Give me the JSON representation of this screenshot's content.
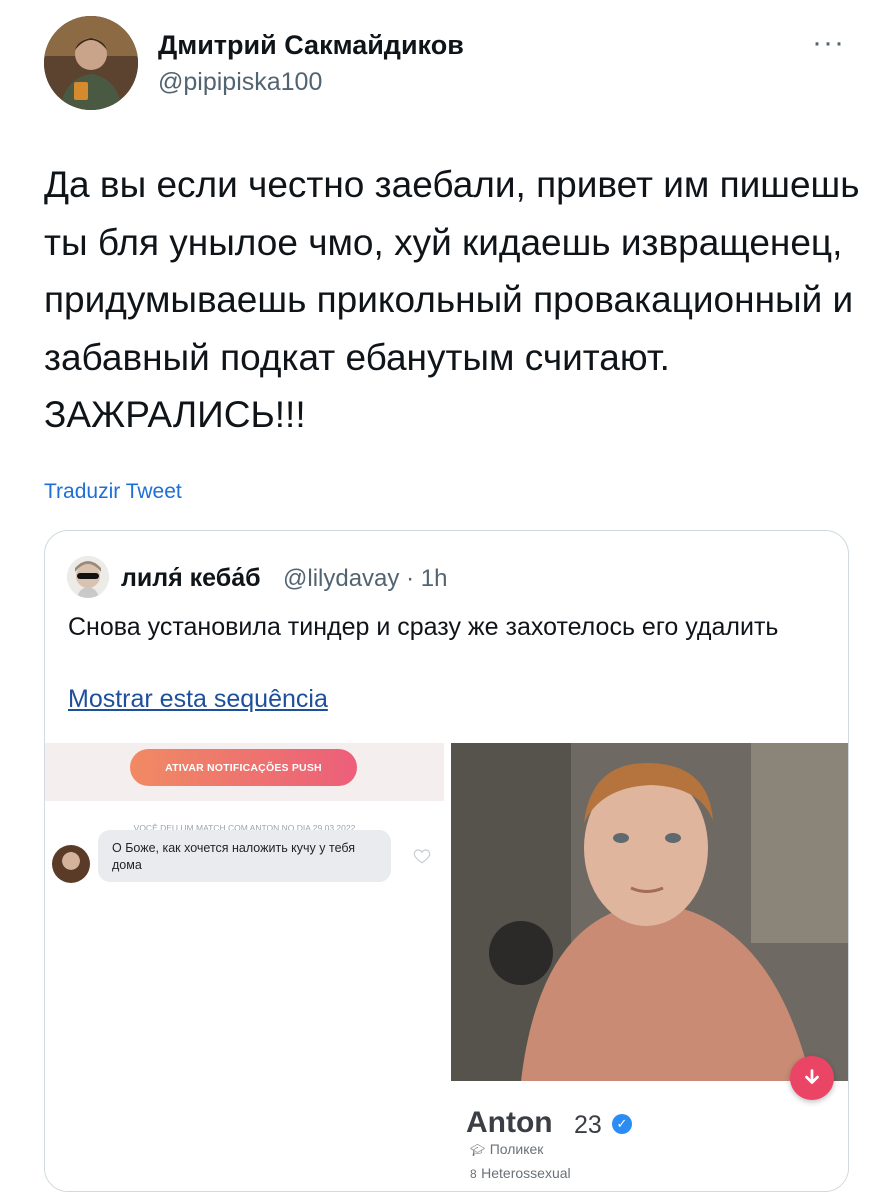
{
  "tweet": {
    "author_name": "Дмитрий Сакмайдиков",
    "author_handle": "@pipipiska100",
    "more_label": "···",
    "text": "Да вы если честно заебали, привет им пишешь ты бля унылое чмо, хуй кидаешь извращенец, придумываешь прикольный провакационный и забавный подкат ебанутым считают. ЗАЖРАЛИСЬ!!!",
    "translate_label": "Traduzir Tweet"
  },
  "quote": {
    "author_name": "лиля́ кеба́б",
    "author_handle": "@lilydavay · 1h",
    "text": "Снова установила тиндер и сразу же захотелось его удалить",
    "show_thread_label": "Mostrar esta sequência"
  },
  "chat_screenshot": {
    "push_button_label": "ATIVAR NOTIFICAÇÕES PUSH",
    "match_notice": "VOCÊ DEU UM MATCH COM ANTON NO DIA 29.03.2022",
    "message_text": "О Боже, как хочется наложить кучу у тебя дома"
  },
  "profile_screenshot": {
    "name": "Anton",
    "age": "23",
    "line1": "Поликек",
    "line2": "Heterossexual"
  },
  "icons": [
    "more-icon",
    "verified-icon",
    "download-icon",
    "heart-icon",
    "graduation-cap-icon",
    "gender-icon"
  ],
  "colors": {
    "link_blue": "#1d6fd6",
    "muted_gray": "#536471",
    "border": "#cfd9de",
    "push_gradient_start": "#f08a63",
    "push_gradient_end": "#ec5f7a",
    "download_button": "#ea4565",
    "verified_blue": "#2b8df4"
  }
}
